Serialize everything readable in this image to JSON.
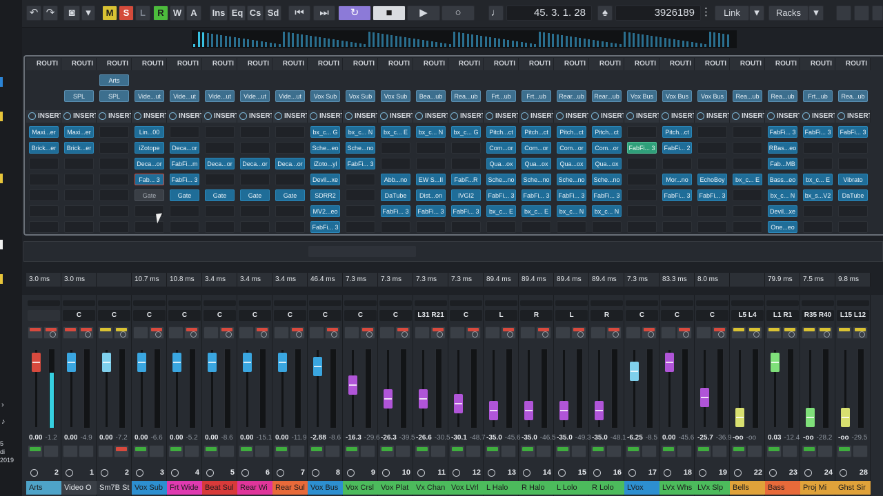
{
  "os": {
    "chips": [
      {
        "color": "#2b84d6"
      },
      {
        "color": "#e8c53a"
      },
      {
        "color": "#e8c53a"
      },
      {
        "color": "#f0f0f0"
      },
      {
        "color": "#e8c53a"
      }
    ],
    "clock_lines": [
      "5",
      "di",
      "2019"
    ]
  },
  "transport": {
    "undo": "↶",
    "redo": "↷",
    "camera": "◙",
    "dropdown": "▾",
    "m": "M",
    "s": "S",
    "l": "L",
    "r": "R",
    "w": "W",
    "a": "A",
    "ins": "Ins",
    "eq": "Eq",
    "cs": "Cs",
    "sd": "Sd",
    "prev": "⏮",
    "next": "⏭",
    "loop": "↻",
    "stop": "■",
    "play": "▶",
    "record": "○",
    "metronome": "♩",
    "position": "45. 3. 1. 28",
    "tempo_icon": "♠",
    "counter": "3926189",
    "more": "⋮",
    "link": "Link",
    "link_menu": "▾",
    "racks": "Racks",
    "racks_menu": "▾"
  },
  "channels": [
    {
      "route": "ROUTI",
      "r1": "",
      "r2": "",
      "ins": [
        "Maxi...er",
        "Brick...er",
        "",
        "",
        "",
        "",
        ""
      ],
      "lat": "3.0 ms",
      "pan": "",
      "vol": "0.00",
      "pk": "-1.2",
      "num": "2",
      "name": "Arts",
      "color": "#4ea3c8",
      "cap": "#d84a3e"
    },
    {
      "route": "ROUTI",
      "r1": "",
      "r2": "SPL",
      "ins": [
        "Maxi...er",
        "Brick...er",
        "",
        "",
        "",
        "",
        ""
      ],
      "lat": "3.0 ms",
      "pan": "C",
      "vol": "0.00",
      "pk": "-4.9",
      "num": "1",
      "name": "Video O",
      "color": "#3a3f46",
      "cap": "#3aa6e0"
    },
    {
      "route": "ROUTI",
      "r1": "Arts",
      "r2": "SPL",
      "ins": [
        "",
        "",
        "",
        "",
        "",
        "",
        ""
      ],
      "lat": "",
      "pan": "C",
      "vol": "0.00",
      "pk": "-7.2",
      "num": "2",
      "name": "Sm7B St",
      "color": "#2f343b",
      "cap": "#7fd0ec"
    },
    {
      "route": "ROUTI",
      "r1": "",
      "r2": "Vide...ut",
      "ins": [
        "Lin...00",
        "iZotope",
        "Deca...or",
        "Fab... 3",
        "Gate",
        "",
        ""
      ],
      "lat": "10.7 ms",
      "pan": "C",
      "vol": "0.00",
      "pk": "-6.6",
      "num": "3",
      "name": "Vox Sub",
      "color": "#2d8fd0",
      "cap": "#3aa6e0"
    },
    {
      "route": "ROUTI",
      "r1": "",
      "r2": "Vide...ut",
      "ins": [
        "",
        "Deca...or",
        "FabFi...m",
        "FabFi... 3",
        "Gate",
        "",
        ""
      ],
      "lat": "10.8 ms",
      "pan": "C",
      "vol": "0.00",
      "pk": "-5.2",
      "num": "4",
      "name": "Frt Wide",
      "color": "#e03ab0",
      "cap": "#3aa6e0"
    },
    {
      "route": "ROUTI",
      "r1": "",
      "r2": "Vide...ut",
      "ins": [
        "",
        "",
        "Deca...or",
        "",
        "Gate",
        "",
        ""
      ],
      "lat": "3.4 ms",
      "pan": "C",
      "vol": "0.00",
      "pk": "-8.6",
      "num": "5",
      "name": "Beat Sul",
      "color": "#d83a3a",
      "cap": "#3aa6e0"
    },
    {
      "route": "ROUTI",
      "r1": "",
      "r2": "Vide...ut",
      "ins": [
        "",
        "",
        "Deca...or",
        "",
        "Gate",
        "",
        ""
      ],
      "lat": "3.4 ms",
      "pan": "C",
      "vol": "0.00",
      "pk": "-15.1",
      "num": "6",
      "name": "Rear Wi",
      "color": "#e0359a",
      "cap": "#3aa6e0"
    },
    {
      "route": "ROUTI",
      "r1": "",
      "r2": "Vide...ut",
      "ins": [
        "",
        "",
        "Deca...or",
        "",
        "Gate",
        "",
        ""
      ],
      "lat": "3.4 ms",
      "pan": "C",
      "vol": "0.00",
      "pk": "-11.9",
      "num": "7",
      "name": "Rear Sul",
      "color": "#e86a3a",
      "cap": "#3aa6e0"
    },
    {
      "route": "ROUTI",
      "r1": "",
      "r2": "Vox Sub",
      "ins": [
        "bx_c... G",
        "Sche...eo",
        "iZoto...yl",
        "Devil...xe",
        "SDRR2",
        "MV2...eo",
        "FabFi... 3"
      ],
      "lat": "46.4 ms",
      "pan": "C",
      "vol": "-2.88",
      "pk": "-8.6",
      "num": "8",
      "name": "Vox Bus",
      "color": "#2d8fd0",
      "cap": "#3aa6e0"
    },
    {
      "route": "ROUTI",
      "r1": "",
      "r2": "Vox Sub",
      "ins": [
        "bx_c... N",
        "Sche...no",
        "FabFi... 3",
        "",
        "",
        "",
        ""
      ],
      "lat": "7.3 ms",
      "pan": "C",
      "vol": "-16.3",
      "pk": "-29.6",
      "num": "9",
      "name": "Vox Crsl",
      "color": "#4cbb5c",
      "cap": "#b055d8"
    },
    {
      "route": "ROUTI",
      "r1": "",
      "r2": "Vox Sub",
      "ins": [
        "bx_c... E",
        "",
        "",
        "Abb...no",
        "DaTube",
        "FabFi... 3",
        ""
      ],
      "lat": "7.3 ms",
      "pan": "C",
      "vol": "-26.3",
      "pk": "-39.5",
      "num": "10",
      "name": "Vox Plat",
      "color": "#4cbb5c",
      "cap": "#b055d8"
    },
    {
      "route": "ROUTI",
      "r1": "",
      "r2": "Bea...ub",
      "ins": [
        "bx_c... N",
        "",
        "",
        "EW S...II",
        "Dist...on",
        "FabFi... 3",
        ""
      ],
      "lat": "7.3 ms",
      "pan": "L31 R21",
      "vol": "-26.6",
      "pk": "-30.5",
      "num": "11",
      "name": "Vx Chan",
      "color": "#4cbb5c",
      "cap": "#b055d8"
    },
    {
      "route": "ROUTI",
      "r1": "",
      "r2": "Rea...ub",
      "ins": [
        "bx_c... G",
        "",
        "",
        "FabF...R",
        "IVGI2",
        "FabFi... 3",
        ""
      ],
      "lat": "7.3 ms",
      "pan": "C",
      "vol": "-30.1",
      "pk": "-48.7",
      "num": "12",
      "name": "Vox LVrl",
      "color": "#4cbb5c",
      "cap": "#b055d8"
    },
    {
      "route": "ROUTI",
      "r1": "",
      "r2": "Frt...ub",
      "ins": [
        "Pitch...ct",
        "Com...or",
        "Qua...ox",
        "Sche...no",
        "FabFi... 3",
        "bx_c... E",
        ""
      ],
      "lat": "89.4 ms",
      "pan": "L",
      "vol": "-35.0",
      "pk": "-45.6",
      "num": "13",
      "name": "L Halo",
      "color": "#4cbb5c",
      "cap": "#b055d8"
    },
    {
      "route": "ROUTI",
      "r1": "",
      "r2": "Frt...ub",
      "ins": [
        "Pitch...ct",
        "Com...or",
        "Qua...ox",
        "Sche...no",
        "FabFi... 3",
        "bx_c... E",
        ""
      ],
      "lat": "89.4 ms",
      "pan": "R",
      "vol": "-35.0",
      "pk": "-46.5",
      "num": "14",
      "name": "R Halo",
      "color": "#4cbb5c",
      "cap": "#b055d8"
    },
    {
      "route": "ROUTI",
      "r1": "",
      "r2": "Rear...ub",
      "ins": [
        "Pitch...ct",
        "Com...or",
        "Qua...ox",
        "Sche...no",
        "FabFi... 3",
        "bx_c... N",
        ""
      ],
      "lat": "89.4 ms",
      "pan": "L",
      "vol": "-35.0",
      "pk": "-49.3",
      "num": "15",
      "name": "L Lolo",
      "color": "#4cbb5c",
      "cap": "#b055d8"
    },
    {
      "route": "ROUTI",
      "r1": "",
      "r2": "Rear...ub",
      "ins": [
        "Pitch...ct",
        "Com...or",
        "Qua...ox",
        "Sche...no",
        "FabFi... 3",
        "bx_c... N",
        ""
      ],
      "lat": "89.4 ms",
      "pan": "R",
      "vol": "-35.0",
      "pk": "-48.1",
      "num": "16",
      "name": "R Lolo",
      "color": "#4cbb5c",
      "cap": "#b055d8"
    },
    {
      "route": "ROUTI",
      "r1": "",
      "r2": "Vox Bus",
      "ins": [
        "",
        "FabFi... 3",
        "",
        "",
        "",
        "",
        ""
      ],
      "lat": "7.3 ms",
      "pan": "C",
      "vol": "-6.25",
      "pk": "-8.5",
      "num": "17",
      "name": "LVox",
      "color": "#2d8fd0",
      "cap": "#7fd0ec"
    },
    {
      "route": "ROUTI",
      "r1": "",
      "r2": "Vox Bus",
      "ins": [
        "Pitch...ct",
        "FabFi... 2",
        "",
        "Mor...no",
        "FabFi... 3",
        "",
        ""
      ],
      "lat": "83.3 ms",
      "pan": "C",
      "vol": "0.00",
      "pk": "-45.6",
      "num": "18",
      "name": "LVx Whs",
      "color": "#4cbb5c",
      "cap": "#b055d8"
    },
    {
      "route": "ROUTI",
      "r1": "",
      "r2": "Vox Bus",
      "ins": [
        "",
        "",
        "",
        "EchoBoy",
        "FabFi... 3",
        "",
        ""
      ],
      "lat": "8.0 ms",
      "pan": "C",
      "vol": "-25.7",
      "pk": "-36.9",
      "num": "19",
      "name": "LVx Slp",
      "color": "#4cbb5c",
      "cap": "#b055d8"
    },
    {
      "route": "ROUTI",
      "r1": "",
      "r2": "Rea...ub",
      "ins": [
        "",
        "",
        "",
        "bx_c... E",
        "",
        "",
        ""
      ],
      "lat": "",
      "pan": "L5 L4",
      "vol": "-oo",
      "pk": "-oo",
      "num": "22",
      "name": "Bells",
      "color": "#e0a23a",
      "cap": "#d8e070"
    },
    {
      "route": "ROUTI",
      "r1": "",
      "r2": "Rea...ub",
      "ins": [
        "FabFi... 3",
        "RBas...eo",
        "Fab...MB",
        "Bass...eo",
        "bx_c... N",
        "Devil...xe",
        "One...eo"
      ],
      "lat": "79.9 ms",
      "pan": "L1 R1",
      "vol": "0.03",
      "pk": "-12.4",
      "num": "23",
      "name": "Bass",
      "color": "#e86a3a",
      "cap": "#7fe07a"
    },
    {
      "route": "ROUTI",
      "r1": "",
      "r2": "Frt...ub",
      "ins": [
        "FabFi... 3",
        "",
        "",
        "bx_c... E",
        "bx_s...V2",
        "",
        ""
      ],
      "lat": "7.5 ms",
      "pan": "R35 R40",
      "vol": "-oo",
      "pk": "-28.2",
      "num": "24",
      "name": "Proj  Mi",
      "color": "#e0a23a",
      "cap": "#7fe07a"
    },
    {
      "route": "ROUTI",
      "r1": "",
      "r2": "Rea...ub",
      "ins": [
        "FabFi... 3",
        "",
        "",
        "Vibrato",
        "DaTube",
        "",
        ""
      ],
      "lat": "9.8 ms",
      "pan": "L15 L12",
      "vol": "-oo",
      "pk": "-29.5",
      "num": "28",
      "name": "Ghst Sir",
      "color": "#e0a23a",
      "cap": "#d8e070"
    }
  ],
  "insert_label": "INSERT",
  "cursor": "pointer"
}
